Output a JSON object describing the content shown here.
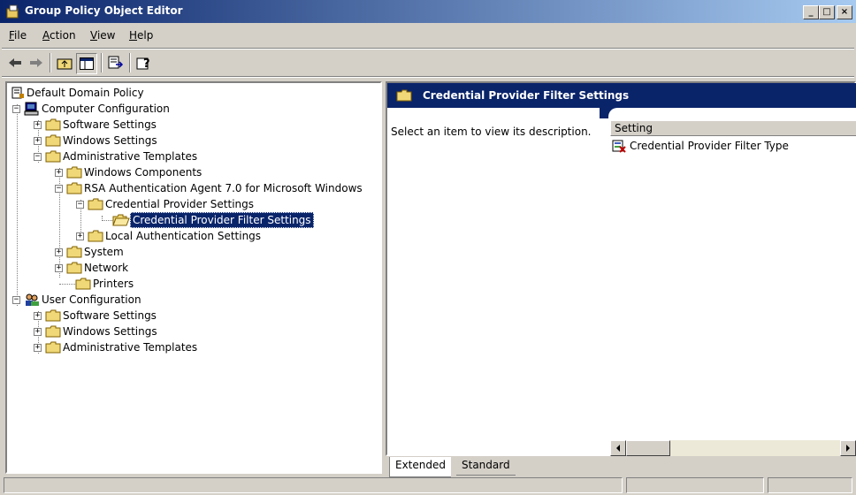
{
  "window": {
    "title": "Group Policy Object Editor",
    "min": "_",
    "max": "□",
    "close": "×"
  },
  "menu": [
    "File",
    "Action",
    "View",
    "Help"
  ],
  "menu_accel": [
    "F",
    "A",
    "V",
    "H"
  ],
  "toolbar": {
    "icons": [
      "back-icon",
      "forward-icon",
      "up-folder-icon",
      "show-hide-tree-icon",
      "export-list-icon",
      "help-icon"
    ]
  },
  "tree": {
    "root": "Default Domain Policy",
    "computer": "Computer Configuration",
    "c_software": "Software Settings",
    "c_windows": "Windows Settings",
    "c_admin": "Administrative Templates",
    "windows_components": "Windows Components",
    "rsa": "RSA Authentication Agent 7.0 for Microsoft Windows",
    "cred_provider": "Credential Provider Settings",
    "cred_filter": "Credential Provider Filter Settings",
    "local_auth": "Local Authentication Settings",
    "system": "System",
    "network": "Network",
    "printers": "Printers",
    "user": "User Configuration",
    "u_software": "Software Settings",
    "u_windows": "Windows Settings",
    "u_admin": "Administrative Templates"
  },
  "right": {
    "header": "Credential Provider Filter Settings",
    "description": "Select an item to view its description.",
    "column": "Setting",
    "items": [
      "Credential Provider Filter Type"
    ]
  },
  "tabs": [
    "Extended",
    "Standard"
  ]
}
